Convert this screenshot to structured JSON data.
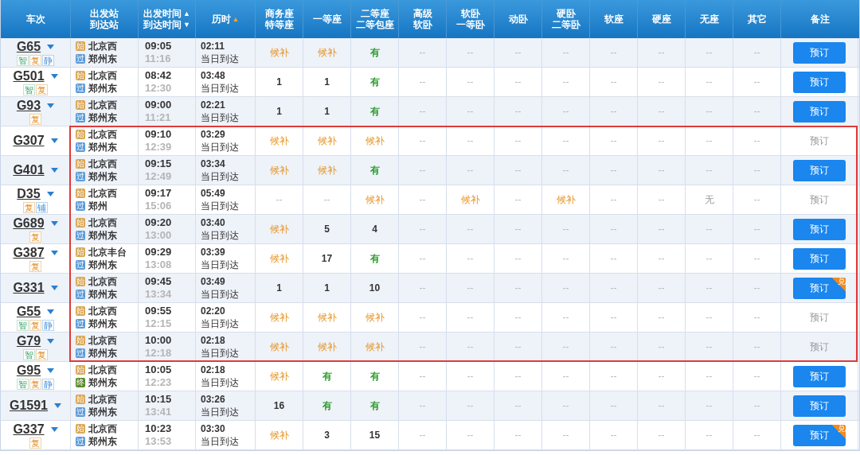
{
  "header": [
    {
      "lines": [
        {
          "text": "车次"
        }
      ]
    },
    {
      "lines": [
        {
          "text": "出发站"
        },
        {
          "text": "到达站"
        }
      ]
    },
    {
      "lines": [
        {
          "text": "出发时间",
          "arrow": "▲",
          "active": false
        },
        {
          "text": "到达时间",
          "arrow": "▼",
          "active": false
        }
      ]
    },
    {
      "lines": [
        {
          "text": "历时",
          "arrow": "▲",
          "active": true
        }
      ]
    },
    {
      "lines": [
        {
          "text": "商务座"
        },
        {
          "text": "特等座"
        }
      ]
    },
    {
      "lines": [
        {
          "text": "一等座"
        }
      ]
    },
    {
      "lines": [
        {
          "text": "二等座"
        },
        {
          "text": "二等包座"
        }
      ]
    },
    {
      "lines": [
        {
          "text": "高级"
        },
        {
          "text": "软卧"
        }
      ]
    },
    {
      "lines": [
        {
          "text": "软卧"
        },
        {
          "text": "一等卧"
        }
      ]
    },
    {
      "lines": [
        {
          "text": "动卧"
        }
      ]
    },
    {
      "lines": [
        {
          "text": "硬卧"
        },
        {
          "text": "二等卧"
        }
      ]
    },
    {
      "lines": [
        {
          "text": "软座"
        }
      ]
    },
    {
      "lines": [
        {
          "text": "硬座"
        }
      ]
    },
    {
      "lines": [
        {
          "text": "无座"
        }
      ]
    },
    {
      "lines": [
        {
          "text": "其它"
        }
      ]
    },
    {
      "lines": [
        {
          "text": "备注"
        }
      ]
    }
  ],
  "rows": [
    {
      "train": "G65",
      "tags": [
        {
          "text": "智",
          "kind": "smart"
        },
        {
          "text": "复",
          "kind": "fuxing"
        },
        {
          "text": "静",
          "kind": "quiet"
        }
      ],
      "from": {
        "mark": "始",
        "kind": "start",
        "name": "北京西"
      },
      "to": {
        "mark": "过",
        "kind": "pass",
        "name": "郑州东"
      },
      "depart": "09:05",
      "arrive": "11:16",
      "duration": "02:11",
      "arrival_day": "当日到达",
      "highlighted": false,
      "seats": [
        {
          "text": "候补",
          "kind": "waitlist"
        },
        {
          "text": "候补",
          "kind": "waitlist"
        },
        {
          "text": "有",
          "kind": "available"
        },
        {
          "text": "--",
          "kind": "none"
        },
        {
          "text": "--",
          "kind": "none"
        },
        {
          "text": "--",
          "kind": "none"
        },
        {
          "text": "--",
          "kind": "none"
        },
        {
          "text": "--",
          "kind": "none"
        },
        {
          "text": "--",
          "kind": "none"
        },
        {
          "text": "--",
          "kind": "none"
        },
        {
          "text": "--",
          "kind": "none"
        }
      ],
      "book": {
        "label": "预订",
        "disabled": false
      }
    },
    {
      "train": "G501",
      "tags": [
        {
          "text": "智",
          "kind": "smart"
        },
        {
          "text": "复",
          "kind": "fuxing"
        }
      ],
      "from": {
        "mark": "始",
        "kind": "start",
        "name": "北京西"
      },
      "to": {
        "mark": "过",
        "kind": "pass",
        "name": "郑州东"
      },
      "depart": "08:42",
      "arrive": "12:30",
      "duration": "03:48",
      "arrival_day": "当日到达",
      "highlighted": false,
      "seats": [
        {
          "text": "1",
          "kind": "count"
        },
        {
          "text": "1",
          "kind": "count"
        },
        {
          "text": "有",
          "kind": "available"
        },
        {
          "text": "--",
          "kind": "none"
        },
        {
          "text": "--",
          "kind": "none"
        },
        {
          "text": "--",
          "kind": "none"
        },
        {
          "text": "--",
          "kind": "none"
        },
        {
          "text": "--",
          "kind": "none"
        },
        {
          "text": "--",
          "kind": "none"
        },
        {
          "text": "--",
          "kind": "none"
        },
        {
          "text": "--",
          "kind": "none"
        }
      ],
      "book": {
        "label": "预订",
        "disabled": false
      }
    },
    {
      "train": "G93",
      "tags": [
        {
          "text": "复",
          "kind": "fuxing"
        }
      ],
      "from": {
        "mark": "始",
        "kind": "start",
        "name": "北京西"
      },
      "to": {
        "mark": "过",
        "kind": "pass",
        "name": "郑州东"
      },
      "depart": "09:00",
      "arrive": "11:21",
      "duration": "02:21",
      "arrival_day": "当日到达",
      "highlighted": false,
      "seats": [
        {
          "text": "1",
          "kind": "count"
        },
        {
          "text": "1",
          "kind": "count"
        },
        {
          "text": "有",
          "kind": "available"
        },
        {
          "text": "--",
          "kind": "none"
        },
        {
          "text": "--",
          "kind": "none"
        },
        {
          "text": "--",
          "kind": "none"
        },
        {
          "text": "--",
          "kind": "none"
        },
        {
          "text": "--",
          "kind": "none"
        },
        {
          "text": "--",
          "kind": "none"
        },
        {
          "text": "--",
          "kind": "none"
        },
        {
          "text": "--",
          "kind": "none"
        }
      ],
      "book": {
        "label": "预订",
        "disabled": false
      }
    },
    {
      "train": "G307",
      "tags": [],
      "from": {
        "mark": "始",
        "kind": "start",
        "name": "北京西"
      },
      "to": {
        "mark": "过",
        "kind": "pass",
        "name": "郑州东"
      },
      "depart": "09:10",
      "arrive": "12:39",
      "duration": "03:29",
      "arrival_day": "当日到达",
      "highlighted": true,
      "seats": [
        {
          "text": "候补",
          "kind": "waitlist"
        },
        {
          "text": "候补",
          "kind": "waitlist"
        },
        {
          "text": "候补",
          "kind": "waitlist"
        },
        {
          "text": "--",
          "kind": "none"
        },
        {
          "text": "--",
          "kind": "none"
        },
        {
          "text": "--",
          "kind": "none"
        },
        {
          "text": "--",
          "kind": "none"
        },
        {
          "text": "--",
          "kind": "none"
        },
        {
          "text": "--",
          "kind": "none"
        },
        {
          "text": "--",
          "kind": "none"
        },
        {
          "text": "--",
          "kind": "none"
        }
      ],
      "book": {
        "label": "预订",
        "disabled": true
      }
    },
    {
      "train": "G401",
      "tags": [],
      "from": {
        "mark": "始",
        "kind": "start",
        "name": "北京西"
      },
      "to": {
        "mark": "过",
        "kind": "pass",
        "name": "郑州东"
      },
      "depart": "09:15",
      "arrive": "12:49",
      "duration": "03:34",
      "arrival_day": "当日到达",
      "highlighted": true,
      "seats": [
        {
          "text": "候补",
          "kind": "waitlist"
        },
        {
          "text": "候补",
          "kind": "waitlist"
        },
        {
          "text": "有",
          "kind": "available"
        },
        {
          "text": "--",
          "kind": "none"
        },
        {
          "text": "--",
          "kind": "none"
        },
        {
          "text": "--",
          "kind": "none"
        },
        {
          "text": "--",
          "kind": "none"
        },
        {
          "text": "--",
          "kind": "none"
        },
        {
          "text": "--",
          "kind": "none"
        },
        {
          "text": "--",
          "kind": "none"
        },
        {
          "text": "--",
          "kind": "none"
        }
      ],
      "book": {
        "label": "预订",
        "disabled": false
      }
    },
    {
      "train": "D35",
      "tags": [
        {
          "text": "复",
          "kind": "fuxing"
        },
        {
          "text": "铺",
          "kind": "berth"
        }
      ],
      "from": {
        "mark": "始",
        "kind": "start",
        "name": "北京西"
      },
      "to": {
        "mark": "过",
        "kind": "pass",
        "name": "郑州"
      },
      "depart": "09:17",
      "arrive": "15:06",
      "duration": "05:49",
      "arrival_day": "当日到达",
      "highlighted": true,
      "seats": [
        {
          "text": "--",
          "kind": "none"
        },
        {
          "text": "--",
          "kind": "none"
        },
        {
          "text": "候补",
          "kind": "waitlist"
        },
        {
          "text": "--",
          "kind": "none"
        },
        {
          "text": "候补",
          "kind": "waitlist"
        },
        {
          "text": "--",
          "kind": "none"
        },
        {
          "text": "候补",
          "kind": "waitlist"
        },
        {
          "text": "--",
          "kind": "none"
        },
        {
          "text": "--",
          "kind": "none"
        },
        {
          "text": "无",
          "kind": "soldout"
        },
        {
          "text": "--",
          "kind": "none"
        }
      ],
      "book": {
        "label": "预订",
        "disabled": true
      }
    },
    {
      "train": "G689",
      "tags": [
        {
          "text": "复",
          "kind": "fuxing"
        }
      ],
      "from": {
        "mark": "始",
        "kind": "start",
        "name": "北京西"
      },
      "to": {
        "mark": "过",
        "kind": "pass",
        "name": "郑州东"
      },
      "depart": "09:20",
      "arrive": "13:00",
      "duration": "03:40",
      "arrival_day": "当日到达",
      "highlighted": true,
      "seats": [
        {
          "text": "候补",
          "kind": "waitlist"
        },
        {
          "text": "5",
          "kind": "count"
        },
        {
          "text": "4",
          "kind": "count"
        },
        {
          "text": "--",
          "kind": "none"
        },
        {
          "text": "--",
          "kind": "none"
        },
        {
          "text": "--",
          "kind": "none"
        },
        {
          "text": "--",
          "kind": "none"
        },
        {
          "text": "--",
          "kind": "none"
        },
        {
          "text": "--",
          "kind": "none"
        },
        {
          "text": "--",
          "kind": "none"
        },
        {
          "text": "--",
          "kind": "none"
        }
      ],
      "book": {
        "label": "预订",
        "disabled": false
      }
    },
    {
      "train": "G387",
      "tags": [
        {
          "text": "复",
          "kind": "fuxing"
        }
      ],
      "from": {
        "mark": "始",
        "kind": "start",
        "name": "北京丰台"
      },
      "to": {
        "mark": "过",
        "kind": "pass",
        "name": "郑州东"
      },
      "depart": "09:29",
      "arrive": "13:08",
      "duration": "03:39",
      "arrival_day": "当日到达",
      "highlighted": true,
      "seats": [
        {
          "text": "候补",
          "kind": "waitlist"
        },
        {
          "text": "17",
          "kind": "count"
        },
        {
          "text": "有",
          "kind": "available"
        },
        {
          "text": "--",
          "kind": "none"
        },
        {
          "text": "--",
          "kind": "none"
        },
        {
          "text": "--",
          "kind": "none"
        },
        {
          "text": "--",
          "kind": "none"
        },
        {
          "text": "--",
          "kind": "none"
        },
        {
          "text": "--",
          "kind": "none"
        },
        {
          "text": "--",
          "kind": "none"
        },
        {
          "text": "--",
          "kind": "none"
        }
      ],
      "book": {
        "label": "预订",
        "disabled": false
      }
    },
    {
      "train": "G331",
      "tags": [],
      "from": {
        "mark": "始",
        "kind": "start",
        "name": "北京西"
      },
      "to": {
        "mark": "过",
        "kind": "pass",
        "name": "郑州东"
      },
      "depart": "09:45",
      "arrive": "13:34",
      "duration": "03:49",
      "arrival_day": "当日到达",
      "highlighted": true,
      "seats": [
        {
          "text": "1",
          "kind": "count"
        },
        {
          "text": "1",
          "kind": "count"
        },
        {
          "text": "10",
          "kind": "count"
        },
        {
          "text": "--",
          "kind": "none"
        },
        {
          "text": "--",
          "kind": "none"
        },
        {
          "text": "--",
          "kind": "none"
        },
        {
          "text": "--",
          "kind": "none"
        },
        {
          "text": "--",
          "kind": "none"
        },
        {
          "text": "--",
          "kind": "none"
        },
        {
          "text": "--",
          "kind": "none"
        },
        {
          "text": "--",
          "kind": "none"
        }
      ],
      "book": {
        "label": "预订",
        "disabled": false,
        "badge": "兑"
      }
    },
    {
      "train": "G55",
      "tags": [
        {
          "text": "智",
          "kind": "smart"
        },
        {
          "text": "复",
          "kind": "fuxing"
        },
        {
          "text": "静",
          "kind": "quiet"
        }
      ],
      "from": {
        "mark": "始",
        "kind": "start",
        "name": "北京西"
      },
      "to": {
        "mark": "过",
        "kind": "pass",
        "name": "郑州东"
      },
      "depart": "09:55",
      "arrive": "12:15",
      "duration": "02:20",
      "arrival_day": "当日到达",
      "highlighted": true,
      "seats": [
        {
          "text": "候补",
          "kind": "waitlist"
        },
        {
          "text": "候补",
          "kind": "waitlist"
        },
        {
          "text": "候补",
          "kind": "waitlist"
        },
        {
          "text": "--",
          "kind": "none"
        },
        {
          "text": "--",
          "kind": "none"
        },
        {
          "text": "--",
          "kind": "none"
        },
        {
          "text": "--",
          "kind": "none"
        },
        {
          "text": "--",
          "kind": "none"
        },
        {
          "text": "--",
          "kind": "none"
        },
        {
          "text": "--",
          "kind": "none"
        },
        {
          "text": "--",
          "kind": "none"
        }
      ],
      "book": {
        "label": "预订",
        "disabled": true
      }
    },
    {
      "train": "G79",
      "tags": [
        {
          "text": "智",
          "kind": "smart"
        },
        {
          "text": "复",
          "kind": "fuxing"
        }
      ],
      "from": {
        "mark": "始",
        "kind": "start",
        "name": "北京西"
      },
      "to": {
        "mark": "过",
        "kind": "pass",
        "name": "郑州东"
      },
      "depart": "10:00",
      "arrive": "12:18",
      "duration": "02:18",
      "arrival_day": "当日到达",
      "highlighted": true,
      "seats": [
        {
          "text": "候补",
          "kind": "waitlist"
        },
        {
          "text": "候补",
          "kind": "waitlist"
        },
        {
          "text": "候补",
          "kind": "waitlist"
        },
        {
          "text": "--",
          "kind": "none"
        },
        {
          "text": "--",
          "kind": "none"
        },
        {
          "text": "--",
          "kind": "none"
        },
        {
          "text": "--",
          "kind": "none"
        },
        {
          "text": "--",
          "kind": "none"
        },
        {
          "text": "--",
          "kind": "none"
        },
        {
          "text": "--",
          "kind": "none"
        },
        {
          "text": "--",
          "kind": "none"
        }
      ],
      "book": {
        "label": "预订",
        "disabled": true
      }
    },
    {
      "train": "G95",
      "tags": [
        {
          "text": "智",
          "kind": "smart"
        },
        {
          "text": "复",
          "kind": "fuxing"
        },
        {
          "text": "静",
          "kind": "quiet"
        }
      ],
      "from": {
        "mark": "始",
        "kind": "start",
        "name": "北京西"
      },
      "to": {
        "mark": "终",
        "kind": "end",
        "name": "郑州东"
      },
      "depart": "10:05",
      "arrive": "12:23",
      "duration": "02:18",
      "arrival_day": "当日到达",
      "highlighted": false,
      "seats": [
        {
          "text": "候补",
          "kind": "waitlist"
        },
        {
          "text": "有",
          "kind": "available"
        },
        {
          "text": "有",
          "kind": "available"
        },
        {
          "text": "--",
          "kind": "none"
        },
        {
          "text": "--",
          "kind": "none"
        },
        {
          "text": "--",
          "kind": "none"
        },
        {
          "text": "--",
          "kind": "none"
        },
        {
          "text": "--",
          "kind": "none"
        },
        {
          "text": "--",
          "kind": "none"
        },
        {
          "text": "--",
          "kind": "none"
        },
        {
          "text": "--",
          "kind": "none"
        }
      ],
      "book": {
        "label": "预订",
        "disabled": false
      }
    },
    {
      "train": "G1591",
      "tags": [],
      "from": {
        "mark": "始",
        "kind": "start",
        "name": "北京西"
      },
      "to": {
        "mark": "过",
        "kind": "pass",
        "name": "郑州东"
      },
      "depart": "10:15",
      "arrive": "13:41",
      "duration": "03:26",
      "arrival_day": "当日到达",
      "highlighted": false,
      "seats": [
        {
          "text": "16",
          "kind": "count"
        },
        {
          "text": "有",
          "kind": "available"
        },
        {
          "text": "有",
          "kind": "available"
        },
        {
          "text": "--",
          "kind": "none"
        },
        {
          "text": "--",
          "kind": "none"
        },
        {
          "text": "--",
          "kind": "none"
        },
        {
          "text": "--",
          "kind": "none"
        },
        {
          "text": "--",
          "kind": "none"
        },
        {
          "text": "--",
          "kind": "none"
        },
        {
          "text": "--",
          "kind": "none"
        },
        {
          "text": "--",
          "kind": "none"
        }
      ],
      "book": {
        "label": "预订",
        "disabled": false
      }
    },
    {
      "train": "G337",
      "tags": [
        {
          "text": "复",
          "kind": "fuxing"
        }
      ],
      "from": {
        "mark": "始",
        "kind": "start",
        "name": "北京西"
      },
      "to": {
        "mark": "过",
        "kind": "pass",
        "name": "郑州东"
      },
      "depart": "10:23",
      "arrive": "13:53",
      "duration": "03:30",
      "arrival_day": "当日到达",
      "highlighted": false,
      "seats": [
        {
          "text": "候补",
          "kind": "waitlist"
        },
        {
          "text": "3",
          "kind": "count"
        },
        {
          "text": "15",
          "kind": "count"
        },
        {
          "text": "--",
          "kind": "none"
        },
        {
          "text": "--",
          "kind": "none"
        },
        {
          "text": "--",
          "kind": "none"
        },
        {
          "text": "--",
          "kind": "none"
        },
        {
          "text": "--",
          "kind": "none"
        },
        {
          "text": "--",
          "kind": "none"
        },
        {
          "text": "--",
          "kind": "none"
        },
        {
          "text": "--",
          "kind": "none"
        }
      ],
      "book": {
        "label": "预订",
        "disabled": false,
        "badge": "兑"
      }
    }
  ]
}
